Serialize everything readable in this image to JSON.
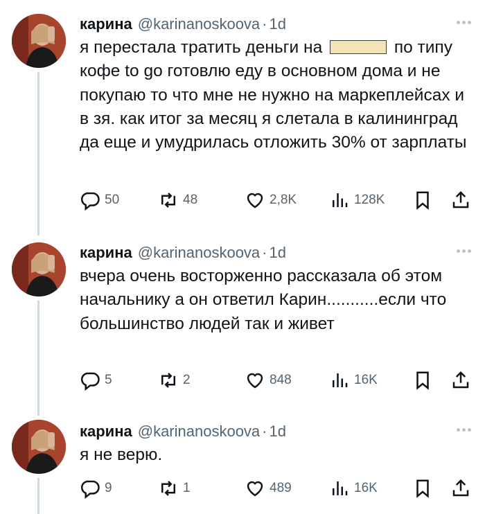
{
  "tweets": [
    {
      "author": {
        "name": "карина",
        "handle": "@karinanoskoova",
        "time": "1d"
      },
      "text_part1": "я перестала тратить деньги на ",
      "text_part2": " по типу кофе to go готовлю еду в основном дома и не покупаю то что мне не нужно на маркеплейсах и в зя. как итог за месяц я слетала в калининград да еще и умудрилась отложить 30% от зарплаты",
      "stats": {
        "replies": "50",
        "retweets": "48",
        "likes": "2,8K",
        "views": "128K"
      }
    },
    {
      "author": {
        "name": "карина",
        "handle": "@karinanoskoova",
        "time": "1d"
      },
      "text": "вчера очень восторженно рассказала об этом начальнику а он ответил Карин...........если что большинство людей так и живет",
      "stats": {
        "replies": "5",
        "retweets": "2",
        "likes": "848",
        "views": "16K"
      }
    },
    {
      "author": {
        "name": "карина",
        "handle": "@karinanoskoova",
        "time": "1d"
      },
      "text": "я не верю.",
      "stats": {
        "replies": "9",
        "retweets": "1",
        "likes": "489",
        "views": "16K"
      }
    }
  ],
  "icons": {
    "reply": "reply-icon",
    "retweet": "retweet-icon",
    "like": "heart-icon",
    "views": "views-icon",
    "bookmark": "bookmark-icon",
    "share": "share-icon",
    "more": "more-icon"
  },
  "colors": {
    "text": "#0f1419",
    "secondary": "#536471",
    "thread_line": "#cfd9de",
    "redaction": "#f3e3b6"
  }
}
